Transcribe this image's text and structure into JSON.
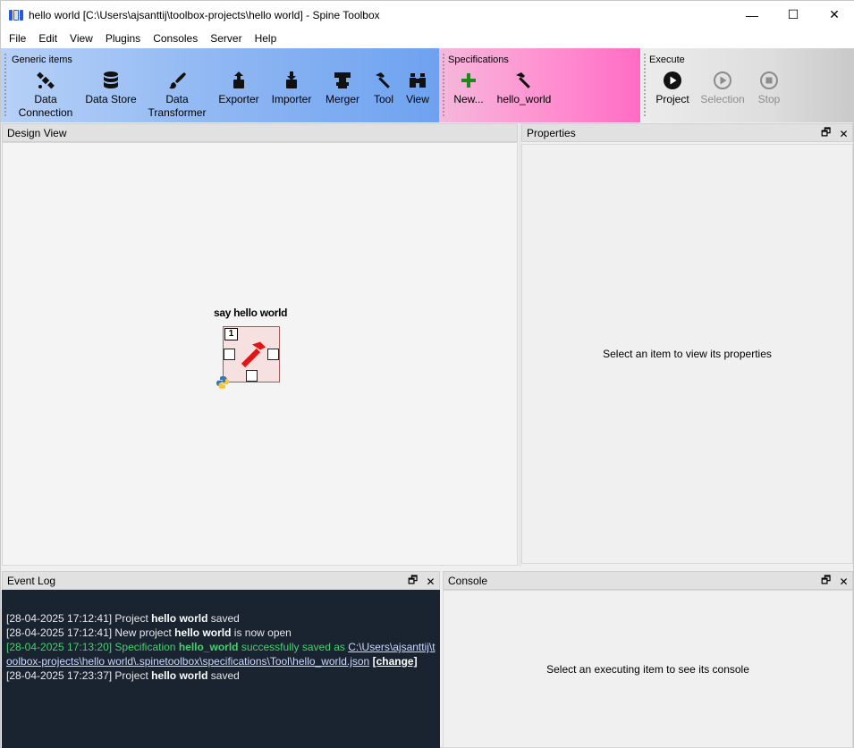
{
  "window": {
    "title": "hello world [C:\\Users\\ajsanttij\\toolbox-projects\\hello world] - Spine Toolbox",
    "minimize": "—",
    "maximize": "☐",
    "close": "✕"
  },
  "menu": [
    "File",
    "Edit",
    "View",
    "Plugins",
    "Consoles",
    "Server",
    "Help"
  ],
  "toolbar": {
    "generic": {
      "label": "Generic items",
      "items": [
        {
          "line1": "Data",
          "line2": "Connection",
          "icon": "satellite-icon"
        },
        {
          "line1": "Data Store",
          "line2": "",
          "icon": "database-icon"
        },
        {
          "line1": "Data",
          "line2": "Transformer",
          "icon": "paintbrush-icon"
        },
        {
          "line1": "Exporter",
          "line2": "",
          "icon": "export-icon"
        },
        {
          "line1": "Importer",
          "line2": "",
          "icon": "import-icon"
        },
        {
          "line1": "Merger",
          "line2": "",
          "icon": "merger-icon"
        },
        {
          "line1": "Tool",
          "line2": "",
          "icon": "hammer-icon"
        },
        {
          "line1": "View",
          "line2": "",
          "icon": "binoculars-icon"
        }
      ]
    },
    "specs": {
      "label": "Specifications",
      "new_label": "New...",
      "hello_label": "hello_world"
    },
    "execute": {
      "label": "Execute",
      "project_label": "Project",
      "selection_label": "Selection",
      "stop_label": "Stop"
    }
  },
  "design_view": {
    "title": "Design View",
    "item": {
      "name": "say hello world",
      "badge": "1"
    }
  },
  "properties": {
    "title": "Properties",
    "placeholder": "Select an item to view its properties"
  },
  "event_log": {
    "title": "Event Log",
    "entries": {
      "e1": {
        "ts": "[28-04-2025 17:12:41] Project ",
        "name": "hello world",
        "rest": " saved"
      },
      "e2": {
        "ts": "[28-04-2025 17:12:41] New project ",
        "name": "hello world",
        "rest": " is now open"
      },
      "e3": {
        "ts": "[28-04-2025 17:13:20] Specification ",
        "name": "hello_world",
        "rest": " successfully saved as ",
        "path": "C:\\Users\\ajsanttij\\toolbox-projects\\hello world\\.spinetoolbox\\specifications\\Tool\\hello_world.json",
        "change": "[change]"
      },
      "e4": {
        "ts": "[28-04-2025 17:23:37] Project ",
        "name": "hello world",
        "rest": " saved"
      }
    }
  },
  "console": {
    "title": "Console",
    "placeholder": "Select an executing item to see its console"
  },
  "dock": {
    "float": "🗗",
    "close": "✕"
  }
}
